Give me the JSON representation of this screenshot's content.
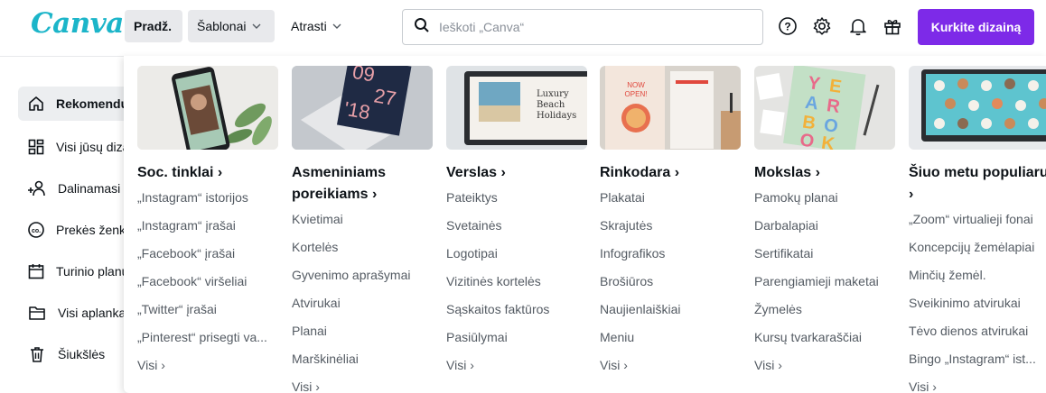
{
  "app": {
    "logo": "Canva"
  },
  "header": {
    "nav": [
      {
        "label": "Pradž."
      },
      {
        "label": "Šablonai"
      },
      {
        "label": "Atrasti"
      }
    ],
    "search": {
      "placeholder": "Ieškoti „Canva“"
    },
    "icons": [
      "help-icon",
      "settings-icon",
      "bell-icon",
      "gift-icon"
    ],
    "cta": "Kurkite dizainą",
    "accent": "#7d2ae8"
  },
  "sidebar": {
    "items": [
      {
        "label": "Rekomenduojama",
        "icon": "home-icon"
      },
      {
        "label": "Visi jūsų dizainai",
        "icon": "grid-icon"
      },
      {
        "label": "Dalinamasi su jumis",
        "icon": "people-icon"
      },
      {
        "label": "Prekės ženklo rinkinys",
        "icon": "brand-icon"
      },
      {
        "label": "Turinio planuoklis",
        "icon": "calendar-icon"
      },
      {
        "label": "Visi aplankai",
        "icon": "folder-icon"
      },
      {
        "label": "Šiukšlės",
        "icon": "trash-icon"
      }
    ]
  },
  "menu": {
    "more_label": "Visi",
    "columns": [
      {
        "title": "Soc. tinklai",
        "items": [
          "„Instagram“ istorijos",
          "„Instagram“ įrašai",
          "„Facebook“ įrašai",
          "„Facebook“ viršeliai",
          "„Twitter“ įrašai",
          "„Pinterest“ prisegti va..."
        ]
      },
      {
        "title": "Asmeniniams poreikiams",
        "items": [
          "Kvietimai",
          "Kortelės",
          "Gyvenimo aprašymai",
          "Atvirukai",
          "Planai",
          "Marškinėliai"
        ]
      },
      {
        "title": "Verslas",
        "items": [
          "Pateiktys",
          "Svetainės",
          "Logotipai",
          "Vizitinės kortelės",
          "Sąskaitos faktūros",
          "Pasiūlymai"
        ]
      },
      {
        "title": "Rinkodara",
        "items": [
          "Plakatai",
          "Skrajutės",
          "Infografikos",
          "Brošiūros",
          "Naujienlaiškiai",
          "Meniu"
        ]
      },
      {
        "title": "Mokslas",
        "items": [
          "Pamokų planai",
          "Darbalapiai",
          "Sertifikatai",
          "Parengiamieji maketai",
          "Žymelės",
          "Kursų tvarkaraščiai"
        ]
      },
      {
        "title": "Šiuo metu populiaru",
        "items": [
          "„Zoom“ virtualieji fonai",
          "Koncepcijų žemėlapiai",
          "Minčių žemėl.",
          "Sveikinimo atvirukai",
          "Tėvo dienos atvirukai",
          "Bingo „Instagram“ ist..."
        ]
      }
    ],
    "thumbs": {
      "invite": {
        "line1": "09",
        "line2": "27",
        "line3": "'18"
      },
      "laptop": {
        "line1": "Luxury",
        "line2": "Beach",
        "line3": "Holidays"
      },
      "poster": {
        "line1": "NOW",
        "line2": "OPEN!"
      },
      "yearbook": {
        "letters": [
          "Y",
          "E",
          "A",
          "R",
          "B",
          "O",
          "O",
          "K"
        ]
      }
    }
  }
}
